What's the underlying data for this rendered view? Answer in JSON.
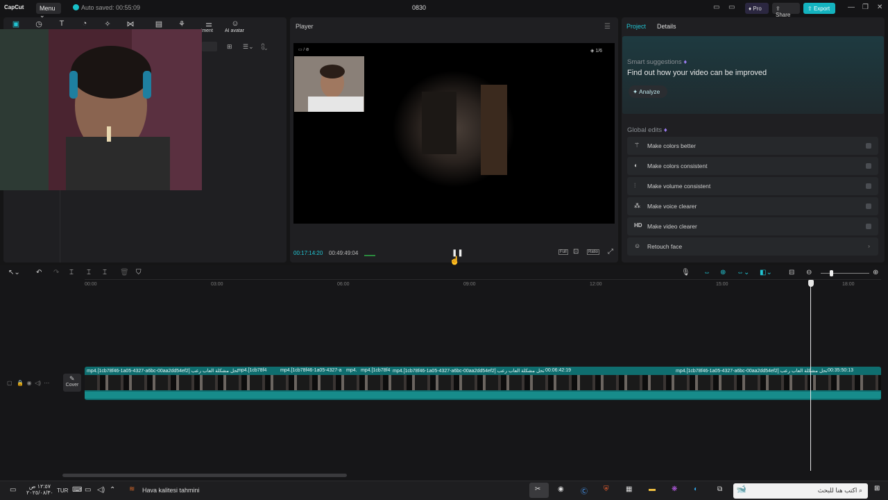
{
  "titlebar": {
    "logo": "CapCut",
    "menu_label": "Menu",
    "autosave": "Auto saved: 00:55:09",
    "project_name": "0830",
    "pro_label": "Pro",
    "share_label": "Share",
    "export_label": "Export",
    "accent_color": "#14b3bf"
  },
  "toolbar": {
    "labels": [
      "ustment",
      "AI avatar"
    ]
  },
  "player": {
    "title": "Player",
    "current_time": "00:17:14:20",
    "total_time": "00:49:49:04",
    "page_indicator": "1/6",
    "buttons": [
      "Full",
      "Ratio"
    ]
  },
  "right_panel": {
    "tabs": [
      "Project",
      "Details"
    ],
    "smart_title": "Smart suggestions",
    "smart_desc": "Find out how your video can be improved",
    "analyze_label": "Analyze",
    "global_title": "Global edits",
    "edits": [
      {
        "label": "Make colors better",
        "icon": "wand-icon"
      },
      {
        "label": "Make colors consistent",
        "icon": "palette-icon"
      },
      {
        "label": "Make volume consistent",
        "icon": "sliders-icon"
      },
      {
        "label": "Make voice clearer",
        "icon": "voice-icon"
      },
      {
        "label": "Make video clearer",
        "icon": "hd-icon",
        "glyph": "HD"
      },
      {
        "label": "Retouch face",
        "icon": "face-icon"
      }
    ]
  },
  "timeline": {
    "ruler": [
      "00:00",
      "03:00",
      "06:00",
      "09:00",
      "12:00",
      "15:00",
      "18:00"
    ],
    "clip_labels": [
      "mp4.[1cb78f46-1a05-4327-a6bc-00aa2dd54ef2] تحل مشكلة العاب رعب",
      "mp4.[1cb78f4",
      "mp4.[1cb78f46-1a05-4327-a",
      "mp4.",
      "mp4.[1cb78f4",
      "mp4.[1cb78f46-1a05-4327-a6bc-00aa2dd54ef2] تحل مشكلة العاب رعب",
      "00:06:42:19",
      "mp4.[1cb78f46-1a05-4327-a6bc-00aa2dd54ef2] تحل مشكلة العاب رعب",
      "00:35:50:13"
    ],
    "cover_label": "Cover"
  },
  "taskbar": {
    "lang": "TUR",
    "weather": "Hava kalitesi tahmini",
    "clock_time": "١٢:٥٧ ص",
    "clock_date": "٢٠٢٥/٠٨/٣٠",
    "search_placeholder": "اكتب هنا للبحث"
  }
}
